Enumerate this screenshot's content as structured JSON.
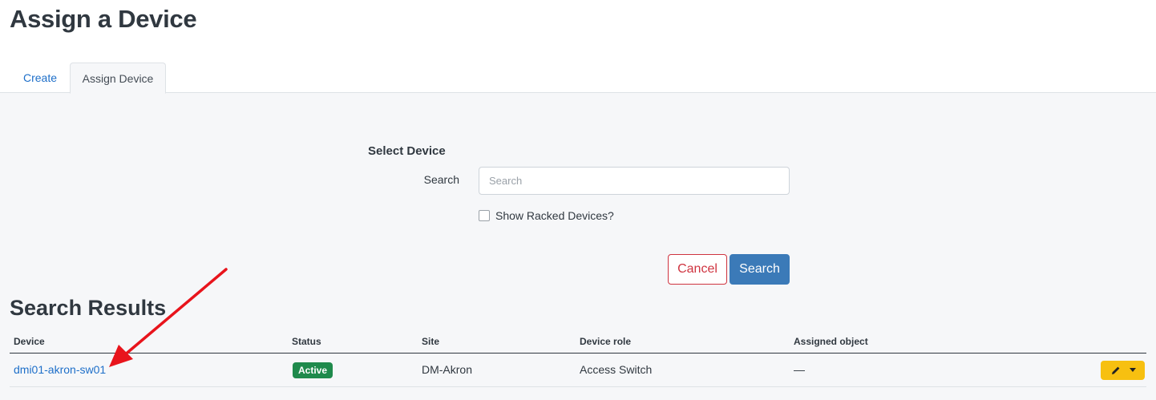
{
  "page": {
    "title": "Assign a Device"
  },
  "tabs": [
    {
      "label": "Create",
      "active": false
    },
    {
      "label": "Assign Device",
      "active": true
    }
  ],
  "form": {
    "section_label": "Select Device",
    "search_label": "Search",
    "search_placeholder": "Search",
    "search_value": "",
    "checkbox_label": "Show Racked Devices?",
    "checkbox_checked": false,
    "cancel_label": "Cancel",
    "submit_label": "Search"
  },
  "results": {
    "title": "Search Results",
    "columns": [
      "Device",
      "Status",
      "Site",
      "Device role",
      "Assigned object"
    ],
    "rows": [
      {
        "device": "dmi01-akron-sw01",
        "status": "Active",
        "site": "DM-Akron",
        "device_role": "Access Switch",
        "assigned_object": "—"
      }
    ]
  },
  "colors": {
    "link": "#1e6fc9",
    "status_active": "#1f8a4c",
    "cancel": "#cf3440",
    "primary": "#3b7ab8",
    "action": "#f7c010",
    "annotation_arrow": "#e8141c"
  },
  "icons": {
    "action_edit": "pencil-icon",
    "action_menu": "caret-down-icon",
    "annotation": "red-arrow-annotation"
  }
}
